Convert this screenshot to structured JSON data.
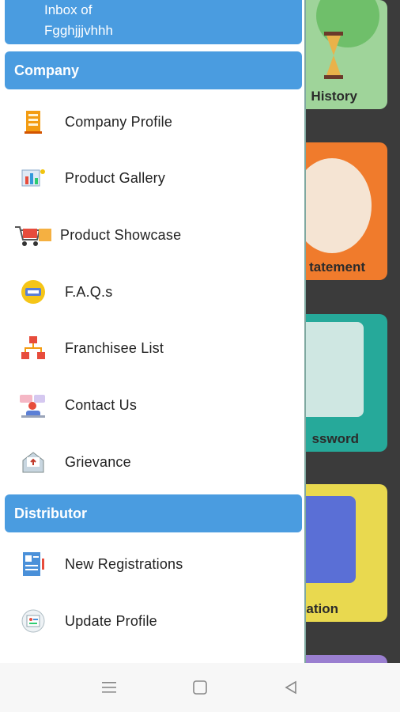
{
  "drawer": {
    "inbox_line1": "Inbox of",
    "inbox_line2": "Fgghjjjvhhh",
    "sections": [
      {
        "title": "Company",
        "items": [
          {
            "label": "Company Profile",
            "icon": "building-icon"
          },
          {
            "label": "Product Gallery",
            "icon": "gallery-icon"
          },
          {
            "label": "Product Showcase",
            "icon": "shopping-cart-icon"
          },
          {
            "label": "F.A.Q.s",
            "icon": "faq-icon"
          },
          {
            "label": "Franchisee List",
            "icon": "network-icon"
          },
          {
            "label": "Contact Us",
            "icon": "contact-icon"
          },
          {
            "label": "Grievance",
            "icon": "mail-upload-icon"
          }
        ]
      },
      {
        "title": "Distributor",
        "items": [
          {
            "label": "New Registrations",
            "icon": "registration-form-icon"
          },
          {
            "label": "Update Profile",
            "icon": "profile-card-icon"
          }
        ]
      }
    ]
  },
  "background_cards": [
    {
      "label": "History",
      "color": "#9fd49a"
    },
    {
      "label": "tatement",
      "color": "#f07b2c"
    },
    {
      "label": "ssword",
      "color": "#26a99a"
    },
    {
      "label": "ation",
      "color": "#e9d94f"
    }
  ],
  "navbar": {
    "menu_icon": "menu-icon",
    "home_icon": "home-square-icon",
    "back_icon": "back-triangle-icon"
  },
  "colors": {
    "section_header": "#4a9ce0",
    "drawer_bg": "#ffffff"
  }
}
